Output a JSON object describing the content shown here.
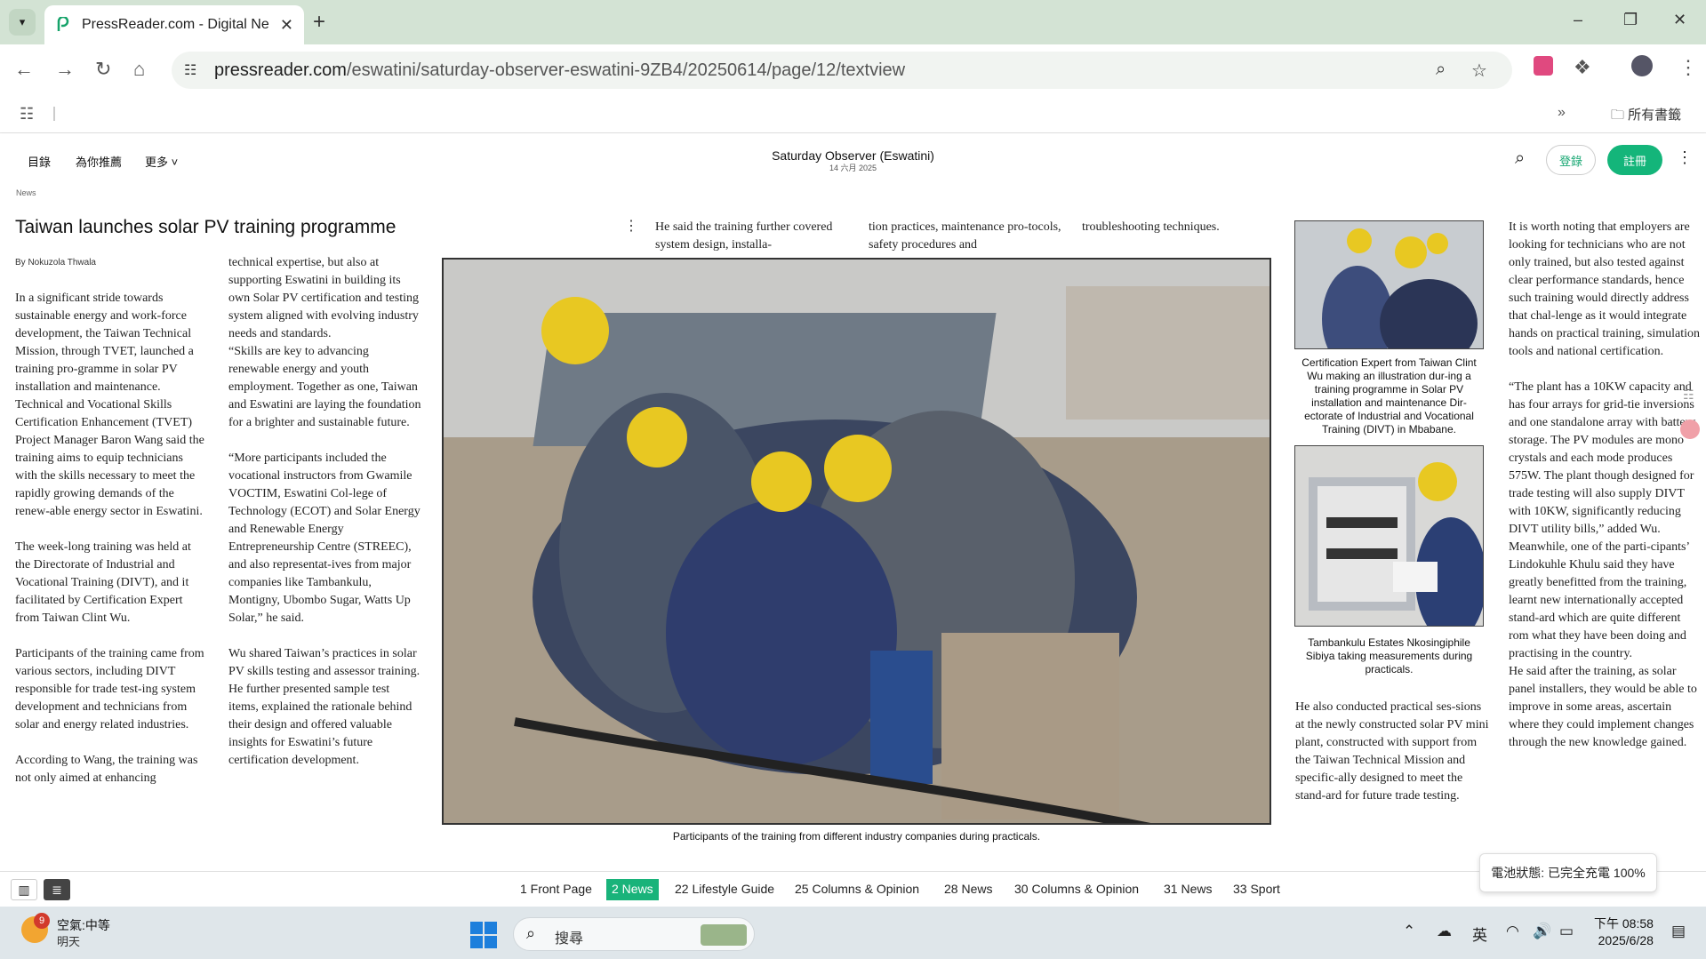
{
  "browser": {
    "tab_title": "PressReader.com - Digital Ne",
    "url_host": "pressreader.com",
    "url_path": "/eswatini/saturday-observer-eswatini-9ZB4/20250614/page/12/textview",
    "bookmarks_folder": "所有書籤"
  },
  "pr_header": {
    "nav": [
      "目錄",
      "為你推薦",
      "更多"
    ],
    "publication": "Saturday Observer (Eswatini)",
    "date": "14 六月 2025",
    "login": "登錄",
    "register": "註冊"
  },
  "article": {
    "section": "News",
    "headline": "Taiwan launches solar PV training programme",
    "byline": "By Nokuzola Thwala",
    "col1": [
      "In a significant stride towards sustainable energy and work-force development, the Taiwan Technical Mission, through TVET, launched a training pro-gramme in solar PV installation and maintenance.",
      "Technical and Vocational Skills Certification Enhancement (TVET) Project Manager Baron Wang said the training aims to equip technicians with the skills necessary to meet the rapidly growing demands of the renew-able energy sector in Eswatini.",
      "The week-long training was held at the Directorate of Industrial and Vocational Training (DIVT), and it facilitated by Certification Expert from Taiwan Clint Wu.",
      "Participants of the training came from various sectors, including DIVT responsible for trade test-ing system development and technicians from solar and energy related industries.",
      "According to Wang, the training was not only aimed at enhancing"
    ],
    "col2": [
      "technical expertise, but also at supporting Eswatini in building its own Solar PV certification and testing system aligned with evolving industry needs and standards.",
      "“Skills are key to advancing renewable energy and youth employment. Together as one, Taiwan and Eswatini are laying the foundation for a brighter and sustainable future.",
      "“More participants included the vocational instructors from Gwamile VOCTIM, Eswatini Col-lege of Technology (ECOT) and Solar Energy and Renewable Energy Entrepreneurship Centre (STREEC), and also representat-ives from major companies like Tambankulu, Montigny, Ubombo Sugar, Watts Up Solar,” he said.",
      "Wu shared Taiwan’s practices in solar PV skills testing and assessor training. He further presented sample test items, explained the rationale behind their design and offered valuable insights for Eswatini’s future certification development."
    ],
    "top_strip": [
      "He said the training further covered system design, installa-",
      "tion practices, maintenance pro-tocols, safety procedures and",
      "troubleshooting techniques."
    ],
    "main_caption": "Participants of the training from different industry companies during practicals.",
    "caption_small_1": "Certification Expert from Taiwan Clint Wu making an illustration dur-ing a training programme in Solar PV installation and maintenance Dir-ectorate of Industrial and Vocational Training (DIVT) in Mbabane.",
    "caption_small_2": "Tambankulu Estates Nkosingiphile Sibiya taking measurements during practicals.",
    "col4": "He also conducted practical ses-sions at the newly constructed solar PV mini plant, constructed with support from the Taiwan Technical Mission and specific-ally designed to meet the stand-ard for future trade testing.",
    "col5": [
      "It is worth noting that employers are looking for technicians who are not only trained, but also tested against clear performance standards, hence such training would directly address that chal-lenge as it would integrate hands on practical training, simulation tools and national certification.",
      "“The plant has a 10KW capacity and has four arrays for grid-tie inversions and one standalone array with battery storage. The PV modules are mono crystals and each mode produces 575W. The plant though designed for trade testing will also supply DIVT with 10KW, significantly reducing DIVT utility bills,” added Wu.",
      "Meanwhile, one of the parti-cipants’ Lindokuhle Khulu said they have greatly benefitted from the training, learnt new internationally accepted stand-ard which are quite different rom what they have been doing and practising in the country.",
      "He said after the training, as solar panel installers, they would be able to improve in some areas, ascertain where they could implement changes through the new knowledge gained."
    ]
  },
  "pagebar": {
    "pages": [
      "1 Front Page",
      "2 News",
      "22 Lifestyle Guide",
      "25 Columns & Opinion",
      "28 News",
      "30 Columns & Opinion",
      "31 News",
      "33 Sport"
    ],
    "active_index": 1,
    "battery_tip": "電池狀態: 已完全充電 100%"
  },
  "taskbar": {
    "weather_badge": "9",
    "weather_line1": "空氣:中等",
    "weather_line2": "明天",
    "search_placeholder": "搜尋",
    "ime": "英",
    "time": "下午 08:58",
    "date": "2025/6/28"
  },
  "colors": {
    "accent": "#14b57a",
    "tab_strip": "#d3e3d4",
    "taskbar": "#dfe6ea"
  }
}
